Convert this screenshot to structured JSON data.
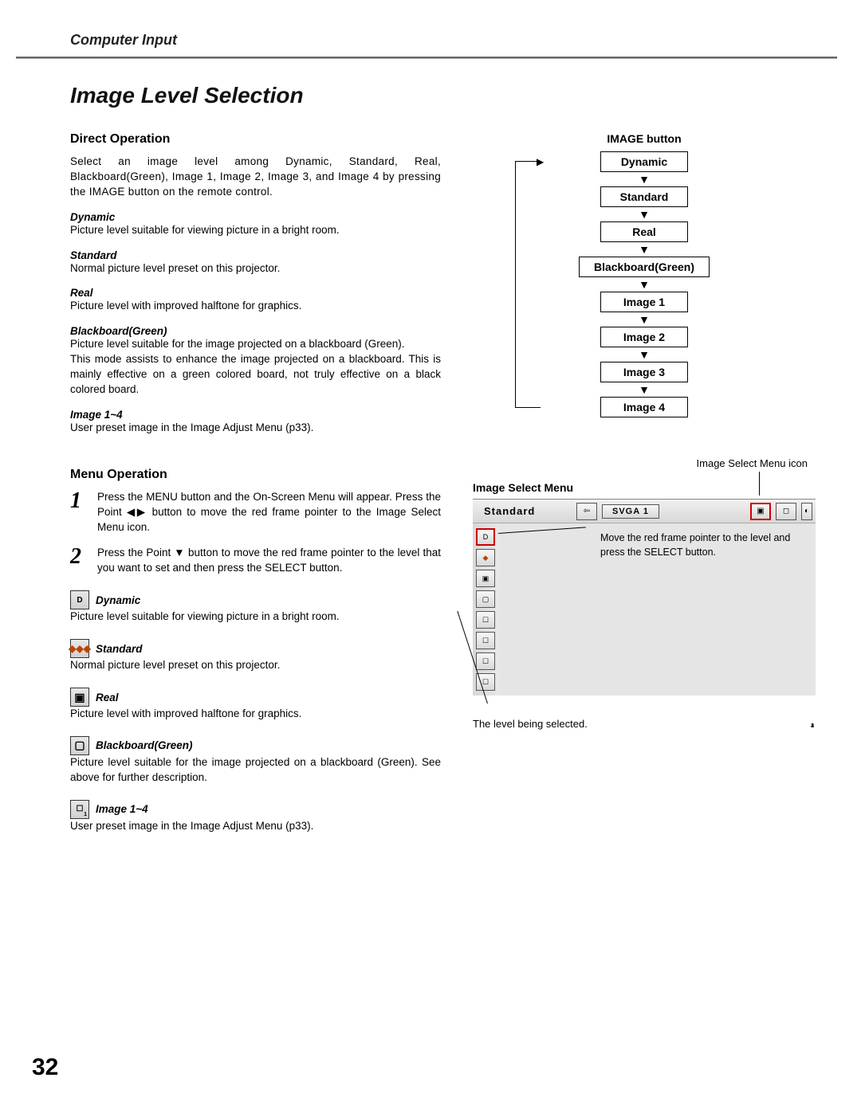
{
  "header": {
    "section": "Computer Input"
  },
  "title": "Image Level Selection",
  "direct": {
    "heading": "Direct Operation",
    "intro": "Select an image level among Dynamic, Standard, Real, Blackboard(Green), Image 1, Image 2, Image 3, and Image 4 by pressing the IMAGE button on the remote control.",
    "items": [
      {
        "label": "Dynamic",
        "desc": "Picture level suitable for viewing picture in a bright room."
      },
      {
        "label": "Standard",
        "desc": "Normal picture level preset on this projector."
      },
      {
        "label": "Real",
        "desc": "Picture level with improved halftone for graphics."
      },
      {
        "label": "Blackboard(Green)",
        "desc": "Picture level suitable for the image projected on a blackboard (Green).\nThis mode assists to enhance the image projected on a blackboard.  This is mainly effective on a green colored board, not truly effective on a black colored board."
      },
      {
        "label": "Image 1~4",
        "desc": "User preset image in the Image Adjust Menu (p33)."
      }
    ]
  },
  "menu": {
    "heading": "Menu Operation",
    "steps": [
      "Press the MENU button and the On-Screen Menu will appear.  Press the Point ◀▶ button to move the red frame pointer to the Image Select Menu icon.",
      "Press the Point ▼ button to move the red frame pointer to the level that you want to set and then press the SELECT button."
    ],
    "items": [
      {
        "icon": "D",
        "label": "Dynamic",
        "desc": "Picture level suitable for viewing picture in a bright room."
      },
      {
        "icon": "◆",
        "label": "Standard",
        "desc": "Normal picture level preset on this projector."
      },
      {
        "icon": "▣",
        "label": "Real",
        "desc": "Picture level with improved halftone for graphics."
      },
      {
        "icon": "▢",
        "label": "Blackboard(Green)",
        "desc": "Picture level suitable for the image projected on a blackboard (Green).   See above for further description."
      },
      {
        "icon": "1",
        "label": "Image 1~4",
        "desc": "User preset image in the Image Adjust Menu (p33)."
      }
    ]
  },
  "flow": {
    "title": "IMAGE button",
    "boxes": [
      "Dynamic",
      "Standard",
      "Real",
      "Blackboard(Green)",
      "Image 1",
      "Image 2",
      "Image 3",
      "Image 4"
    ]
  },
  "osd": {
    "icon_callout": "Image Select Menu icon",
    "heading": "Image Select Menu",
    "topbar_name": "Standard",
    "svga": "SVGA 1",
    "hint": "Move the red frame pointer to the level and press the SELECT button.",
    "caption": "The level being selected."
  },
  "page_number": "32"
}
